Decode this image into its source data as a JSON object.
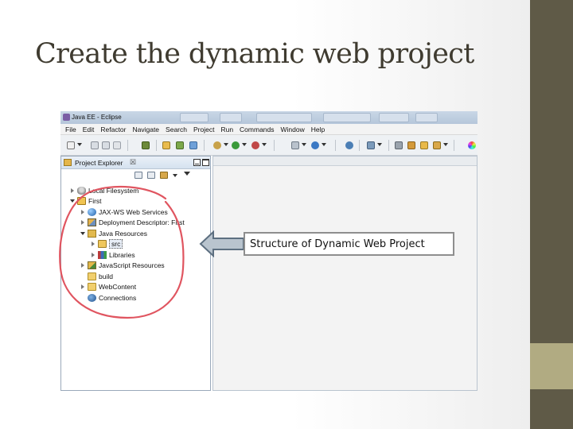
{
  "slide": {
    "title": "Create the dynamic web project"
  },
  "window": {
    "title": "Java EE - Eclipse"
  },
  "menubar": {
    "items": [
      "File",
      "Edit",
      "Refactor",
      "Navigate",
      "Search",
      "Project",
      "Run",
      "Commands",
      "Window",
      "Help"
    ]
  },
  "project_explorer": {
    "tab_label": "Project Explorer",
    "tab_close": "☒",
    "tree": [
      {
        "label": "Local Filesystem",
        "icon": "disk-icon",
        "twisty": "closed"
      },
      {
        "label": "First",
        "icon": "project-icon",
        "twisty": "open"
      },
      {
        "label": "JAX-WS Web Services",
        "icon": "web-services-icon",
        "twisty": "closed"
      },
      {
        "label": "Deployment Descriptor: First",
        "icon": "descriptor-icon",
        "twisty": "closed"
      },
      {
        "label": "Java Resources",
        "icon": "java-resources-icon",
        "twisty": "open"
      },
      {
        "label": "src",
        "icon": "package-folder-icon",
        "twisty": "closed"
      },
      {
        "label": "Libraries",
        "icon": "libraries-icon",
        "twisty": "closed"
      },
      {
        "label": "JavaScript Resources",
        "icon": "javascript-icon",
        "twisty": "closed"
      },
      {
        "label": "build",
        "icon": "folder-icon",
        "twisty": "none"
      },
      {
        "label": "WebContent",
        "icon": "folder-icon",
        "twisty": "closed"
      },
      {
        "label": "Connections",
        "icon": "connections-icon",
        "twisty": "none"
      }
    ]
  },
  "callout": {
    "text": "Structure of Dynamic Web Project"
  },
  "colors": {
    "sidebar_dark": "#5f5a47",
    "sidebar_light": "#b1ab82",
    "highlight_ring": "#e05560",
    "arrow_fill": "#b9c4ce",
    "arrow_stroke": "#5d6f80"
  }
}
